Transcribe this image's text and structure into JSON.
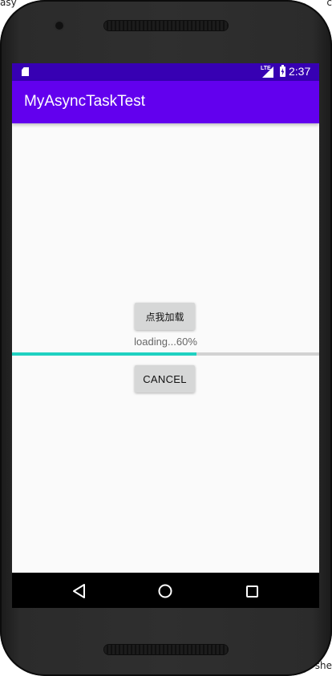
{
  "status_bar": {
    "time": "2:37",
    "network_label": "LTE",
    "icons": [
      "sd-card-icon",
      "signal-icon",
      "battery-charging-icon"
    ]
  },
  "app_bar": {
    "title": "MyAsyncTaskTest"
  },
  "main": {
    "load_button_label": "点我加载",
    "progress_text": "loading...60%",
    "progress_fraction": 0.6,
    "cancel_button_label": "CANCEL"
  },
  "nav_bar": {
    "icons": [
      "back-icon",
      "home-icon",
      "recents-icon"
    ]
  },
  "background_fragments": {
    "top_left": "asy",
    "top_right": "c",
    "bottom_right": "she"
  },
  "colors": {
    "status_bar": "#3700b3",
    "app_bar": "#6200ee",
    "progress": "#1fd1c1",
    "progress_track": "#d2d2d2",
    "button": "#d6d7d7",
    "screen_bg": "#fafafa"
  }
}
